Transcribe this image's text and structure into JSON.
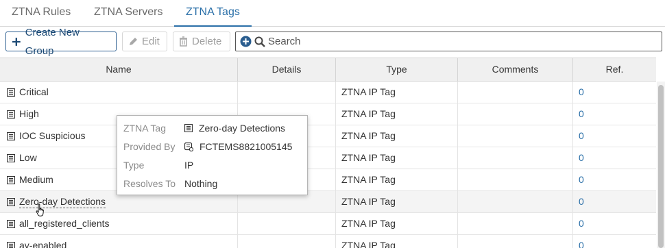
{
  "tabs": [
    {
      "label": "ZTNA Rules",
      "active": false
    },
    {
      "label": "ZTNA Servers",
      "active": false
    },
    {
      "label": "ZTNA Tags",
      "active": true
    }
  ],
  "toolbar": {
    "create_label": "Create New Group",
    "edit_label": "Edit",
    "delete_label": "Delete",
    "search_placeholder": "Search"
  },
  "table": {
    "columns": [
      "Name",
      "Details",
      "Type",
      "Comments",
      "Ref."
    ],
    "rows": [
      {
        "name": "Critical",
        "details": "",
        "type": "ZTNA IP Tag",
        "comments": "",
        "ref": "0"
      },
      {
        "name": "High",
        "details": "",
        "type": "ZTNA IP Tag",
        "comments": "",
        "ref": "0"
      },
      {
        "name": "IOC Suspicious",
        "details": "",
        "type": "ZTNA IP Tag",
        "comments": "",
        "ref": "0"
      },
      {
        "name": "Low",
        "details": "",
        "type": "ZTNA IP Tag",
        "comments": "",
        "ref": "0"
      },
      {
        "name": "Medium",
        "details": "",
        "type": "ZTNA IP Tag",
        "comments": "",
        "ref": "0"
      },
      {
        "name": "Zero-day Detections",
        "details": "",
        "type": "ZTNA IP Tag",
        "comments": "",
        "ref": "0"
      },
      {
        "name": "all_registered_clients",
        "details": "",
        "type": "ZTNA IP Tag",
        "comments": "",
        "ref": "0"
      },
      {
        "name": "av-enabled",
        "details": "",
        "type": "ZTNA IP Tag",
        "comments": "",
        "ref": "0"
      }
    ]
  },
  "tooltip": {
    "rows": [
      {
        "label": "ZTNA Tag",
        "value": "Zero-day Detections",
        "icon": "tag-list-icon"
      },
      {
        "label": "Provided By",
        "value": "FCTEMS8821005145",
        "icon": "ems-server-icon"
      },
      {
        "label": "Type",
        "value": "IP"
      },
      {
        "label": "Resolves To",
        "value": "Nothing"
      }
    ]
  },
  "colors": {
    "accent": "#2a6fa8",
    "primary_button_border": "#2a5d8f",
    "header_bg": "#f0f0f0"
  }
}
